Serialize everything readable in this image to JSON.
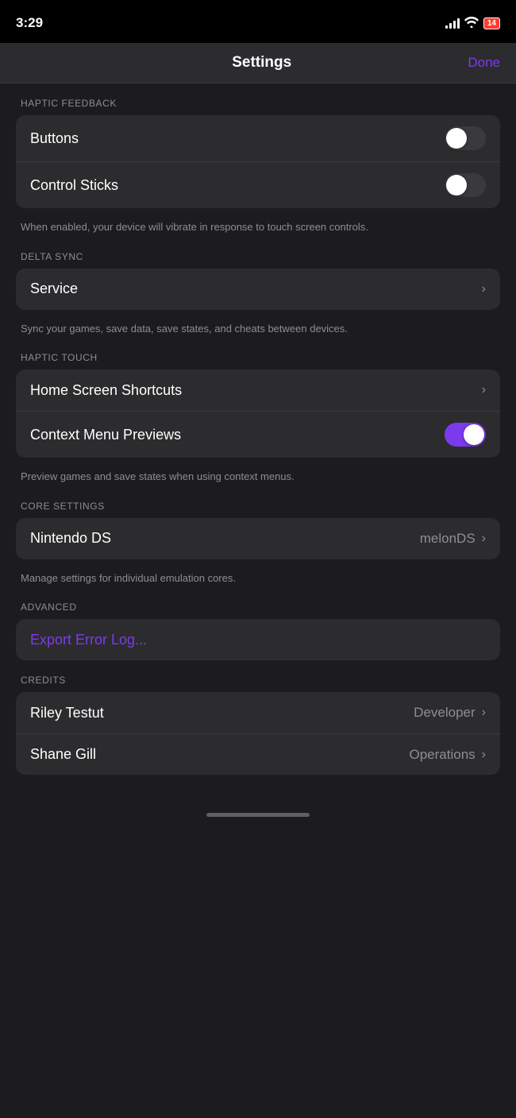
{
  "statusBar": {
    "time": "3:29",
    "battery": "14"
  },
  "navBar": {
    "title": "Settings",
    "done": "Done"
  },
  "sections": [
    {
      "id": "haptic-feedback",
      "label": "HAPTIC FEEDBACK",
      "rows": [
        {
          "id": "buttons",
          "label": "Buttons",
          "type": "toggle",
          "value": false
        },
        {
          "id": "control-sticks",
          "label": "Control Sticks",
          "type": "toggle",
          "value": false
        }
      ],
      "description": "When enabled, your device will vibrate in response to touch screen controls."
    },
    {
      "id": "delta-sync",
      "label": "DELTA SYNC",
      "rows": [
        {
          "id": "service",
          "label": "Service",
          "type": "chevron"
        }
      ],
      "description": "Sync your games, save data, save states, and cheats between devices."
    },
    {
      "id": "haptic-touch",
      "label": "HAPTIC TOUCH",
      "rows": [
        {
          "id": "home-screen-shortcuts",
          "label": "Home Screen Shortcuts",
          "type": "chevron"
        },
        {
          "id": "context-menu-previews",
          "label": "Context Menu Previews",
          "type": "toggle",
          "value": true
        }
      ],
      "description": "Preview games and save states when using context menus."
    },
    {
      "id": "core-settings",
      "label": "CORE SETTINGS",
      "rows": [
        {
          "id": "nintendo-ds",
          "label": "Nintendo DS",
          "type": "chevron",
          "value": "melonDS"
        }
      ],
      "description": "Manage settings for individual emulation cores."
    },
    {
      "id": "advanced",
      "label": "ADVANCED",
      "rows": [
        {
          "id": "export-error-log",
          "label": "Export Error Log...",
          "type": "action"
        }
      ],
      "description": null
    },
    {
      "id": "credits",
      "label": "CREDITS",
      "rows": [
        {
          "id": "riley-testut",
          "label": "Riley Testut",
          "type": "chevron",
          "value": "Developer"
        },
        {
          "id": "shane-gill",
          "label": "Shane Gill",
          "type": "chevron",
          "value": "Operations"
        }
      ],
      "description": null
    }
  ]
}
